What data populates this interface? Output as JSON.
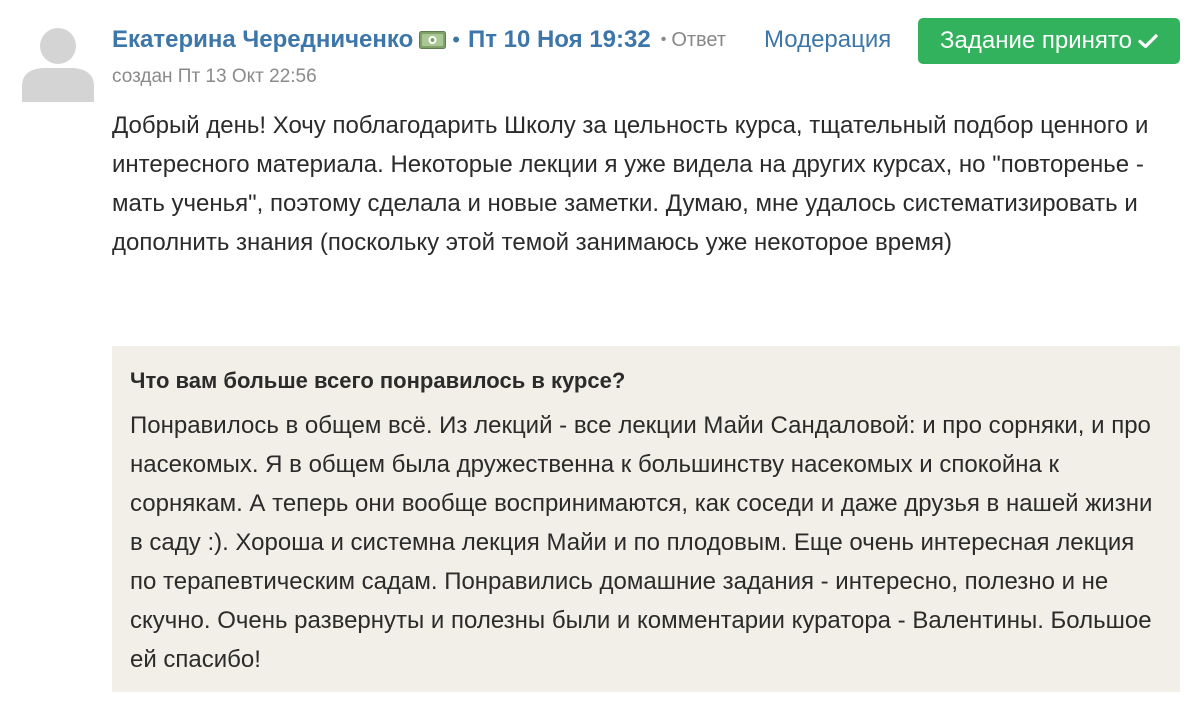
{
  "post": {
    "author": "Екатерина Чередниченко",
    "author_badge_icon": "money-icon",
    "date": "Пт 10 Ноя 19:32",
    "reply_label": "Ответ",
    "moderation_label": "Модерация",
    "status_button_label": "Задание принято",
    "status_button_icon": "check-icon",
    "status_color": "#32b25d",
    "created": "создан Пт 13 Окт 22:56",
    "body": "Добрый день! Хочу поблагодарить Школу за цельность курса, тщательный подбор ценного и интересного материала. Некоторые лекции я уже видела на других курсах, но \"повторенье - мать ученья\", поэтому сделала и новые заметки. Думаю, мне удалось систематизировать и дополнить знания (поскольку этой темой занимаюсь уже некоторое время)"
  },
  "answer": {
    "question": "Что вам больше всего понравилось в курсе?",
    "text": "Понравилось в общем всё. Из лекций - все лекции Майи Сандаловой: и про сорняки, и про насекомых. Я в общем была дружественна к большинству насекомых и спокойна к сорнякам. А теперь они вообще воспринимаются, как соседи и даже друзья в нашей жизни в саду :). Хороша и системна лекция Майи и по плодовым. Еще очень интересная лекция по терапевтическим садам. Понравились домашние задания - интересно, полезно и не скучно. Очень развернуты и полезны были и комментарии куратора - Валентины. Большое ей спасибо!"
  },
  "colors": {
    "link": "#3d76a9",
    "muted": "#8a8a8a",
    "answer_bg": "#f1efe7"
  }
}
